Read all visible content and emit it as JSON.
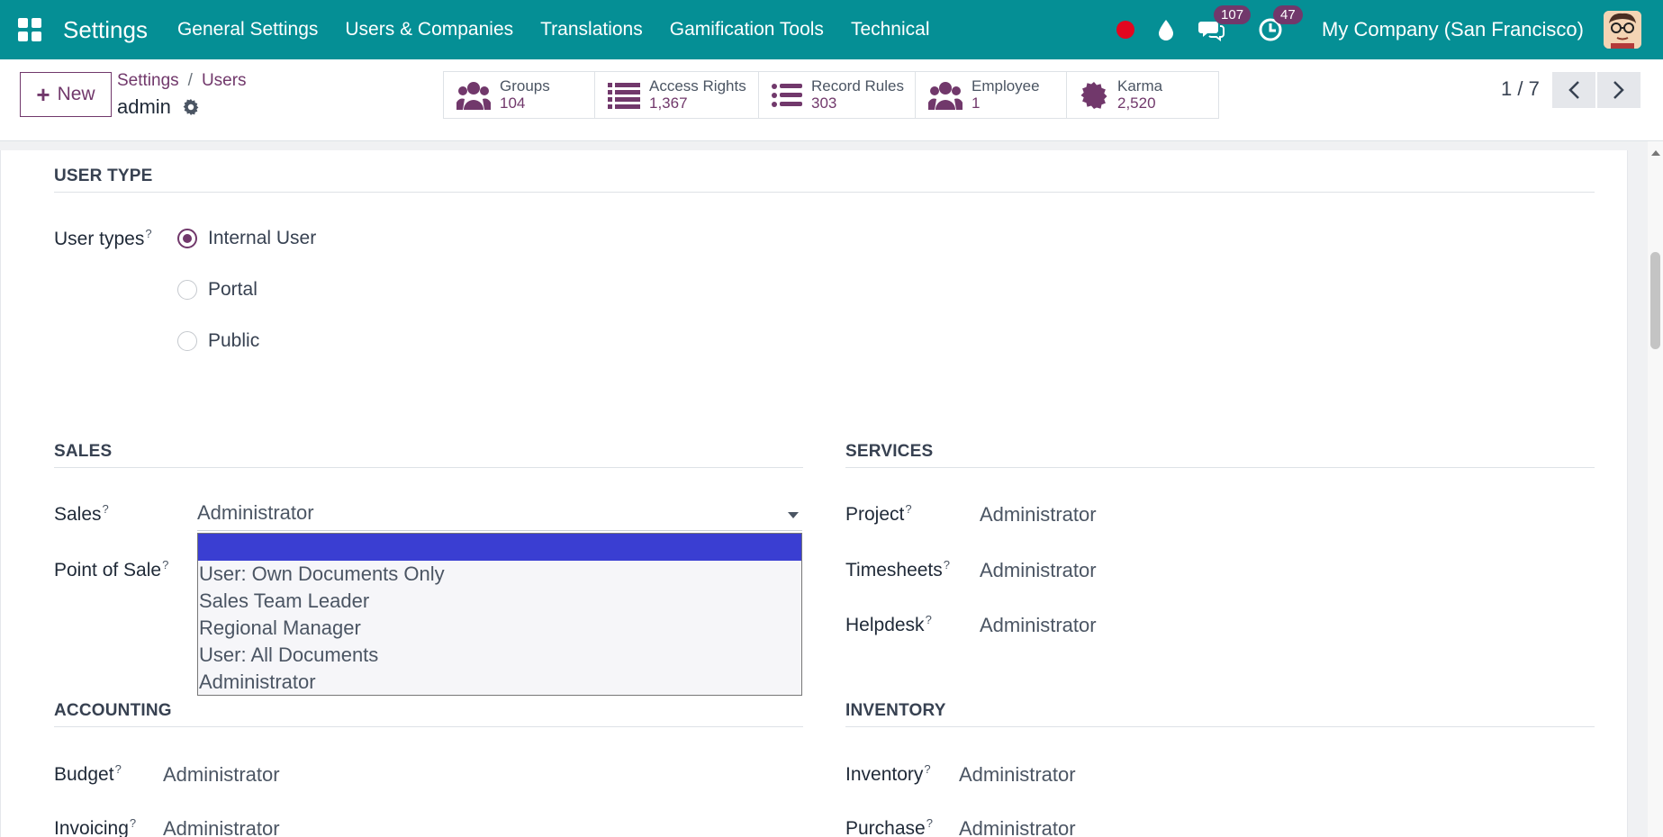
{
  "navbar": {
    "app_name": "Settings",
    "menu": [
      "General Settings",
      "Users & Companies",
      "Translations",
      "Gamification Tools",
      "Technical"
    ],
    "messages_count": "107",
    "activities_count": "47",
    "company": "My Company (San Francisco)",
    "color": "#058f95"
  },
  "control": {
    "new_label": "New",
    "breadcrumb": {
      "parent": "Settings",
      "sep": "/",
      "section": "Users",
      "current": "admin"
    },
    "smart_buttons": [
      {
        "label": "Groups",
        "value": "104",
        "icon": "users-icon"
      },
      {
        "label": "Access Rights",
        "value": "1,367",
        "icon": "list-icon"
      },
      {
        "label": "Record Rules",
        "value": "303",
        "icon": "list-icon"
      },
      {
        "label": "Employee",
        "value": "1",
        "icon": "users-icon"
      },
      {
        "label": "Karma",
        "value": "2,520",
        "icon": "certificate-icon"
      }
    ],
    "pager": "1 / 7"
  },
  "form": {
    "user_type": {
      "title": "USER TYPE",
      "label": "User types",
      "help": "?",
      "options": [
        "Internal User",
        "Portal",
        "Public"
      ],
      "selected": "Internal User"
    },
    "sales": {
      "title": "SALES",
      "fields": [
        {
          "label": "Sales",
          "value": "Administrator"
        },
        {
          "label": "Point of Sale",
          "value": ""
        }
      ],
      "dropdown_options": [
        "",
        "User: Own Documents Only",
        "Sales Team Leader",
        "Regional Manager",
        "User: All Documents",
        "Administrator"
      ]
    },
    "services": {
      "title": "SERVICES",
      "fields": [
        {
          "label": "Project",
          "value": "Administrator"
        },
        {
          "label": "Timesheets",
          "value": "Administrator"
        },
        {
          "label": "Helpdesk",
          "value": "Administrator"
        }
      ]
    },
    "accounting": {
      "title": "ACCOUNTING",
      "fields": [
        {
          "label": "Budget",
          "value": "Administrator"
        },
        {
          "label": "Invoicing",
          "value": "Administrator"
        }
      ]
    },
    "inventory": {
      "title": "INVENTORY",
      "fields": [
        {
          "label": "Inventory",
          "value": "Administrator"
        },
        {
          "label": "Purchase",
          "value": "Administrator"
        }
      ]
    }
  }
}
